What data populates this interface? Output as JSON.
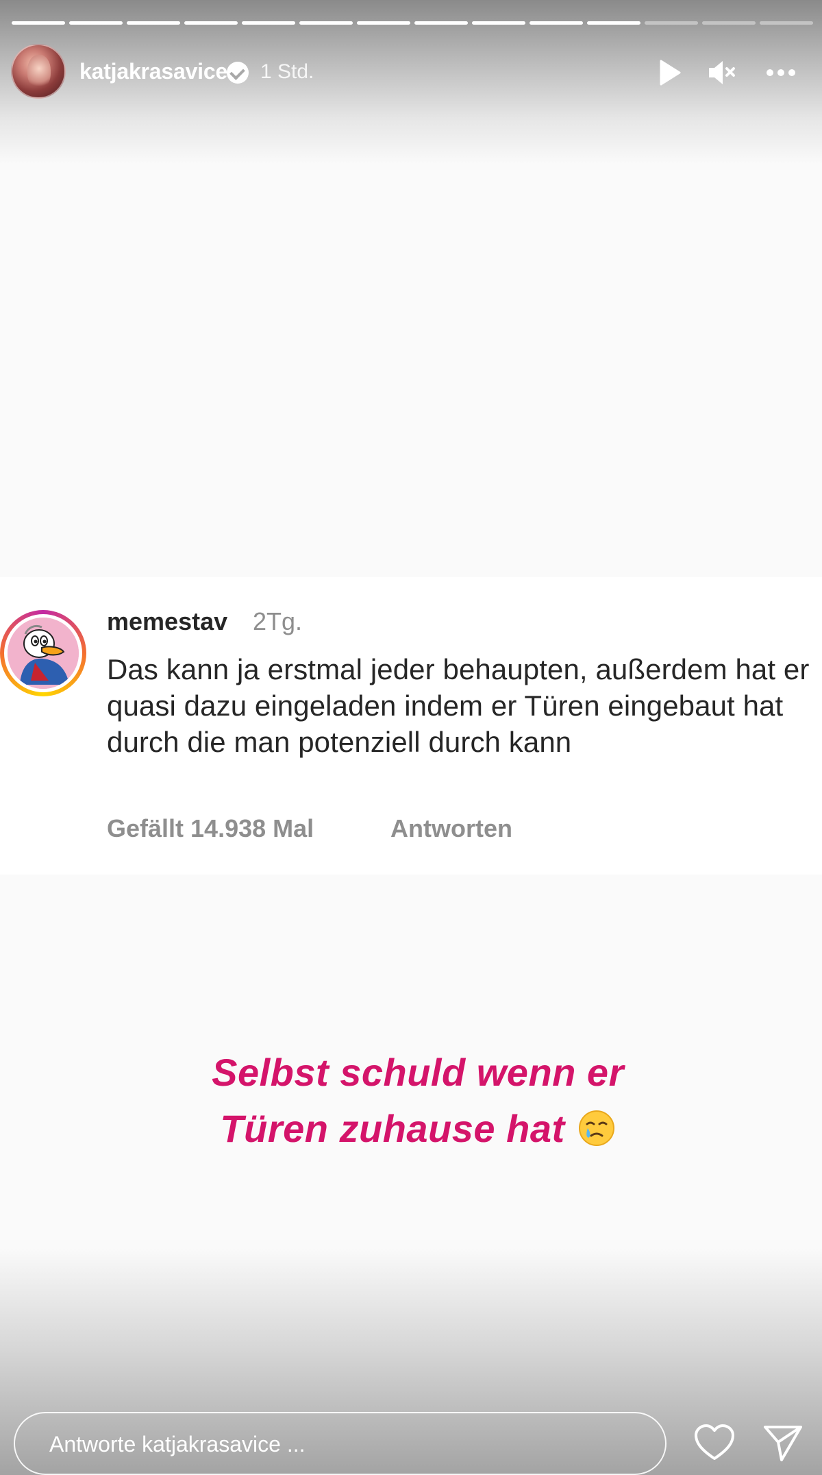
{
  "story": {
    "segments_total": 14,
    "segments_done": 11,
    "username": "katjakrasavice",
    "verified": true,
    "time_ago": "1 Std.",
    "icons": {
      "play": "play-icon",
      "mute": "speaker-muted-icon",
      "more": "more-dots-icon",
      "heart": "heart-icon",
      "send": "send-icon"
    }
  },
  "comment": {
    "username": "memestav",
    "time_ago": "2Tg.",
    "text": "Das kann ja erstmal jeder behaupten, außerdem hat er quasi dazu eingeladen indem er Türen eingebaut hat durch die man potenziell durch kann",
    "likes": "Gefällt 14.938 Mal",
    "reply": "Antworten"
  },
  "caption": {
    "line1": "Selbst schuld wenn er",
    "line2": "Türen zuhause hat",
    "color": "#d4146a",
    "emoji": "face-holding-back-tears-emoji"
  },
  "reply_bar": {
    "placeholder": "Antworte katjakrasavice ..."
  }
}
